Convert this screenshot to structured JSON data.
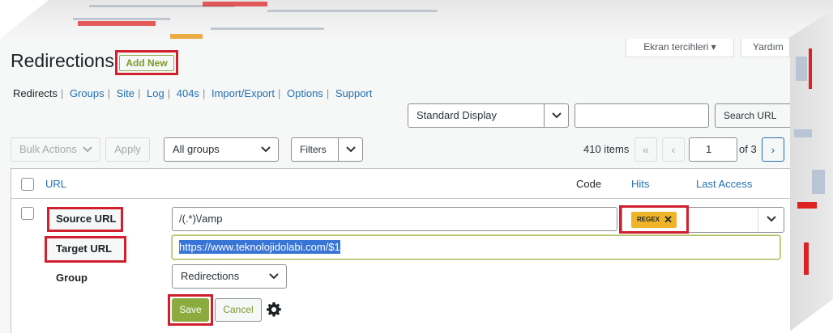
{
  "page": {
    "title": "Redirections",
    "add_new_label": "Add New",
    "screen_options_label": "Ekran tercihleri",
    "help_label": "Yardım"
  },
  "subnav": {
    "items": [
      "Redirects",
      "Groups",
      "Site",
      "Log",
      "404s",
      "Import/Export",
      "Options",
      "Support"
    ]
  },
  "toolbar": {
    "display_select_value": "Standard Display",
    "search_input_value": "",
    "search_button_label": "Search URL",
    "bulk_actions_value": "Bulk Actions",
    "apply_label": "Apply",
    "groups_select_value": "All groups",
    "filters_label": "Filters"
  },
  "pagination": {
    "item_count": "410 items",
    "first_label": "«",
    "prev_label": "‹",
    "current_page": "1",
    "of_label": "of 3",
    "next_label": "›"
  },
  "table": {
    "columns": {
      "url": "URL",
      "code": "Code",
      "hits": "Hits",
      "last_access": "Last Access"
    }
  },
  "edit_form": {
    "source_label": "Source URL",
    "source_value": "/(.*)\\/amp",
    "target_label": "Target URL",
    "target_value": "https://www.teknolojidolabi.com/$1",
    "group_label": "Group",
    "group_value": "Redirections",
    "regex_badge": "REGEX",
    "regex_remove_glyph": "✕",
    "save_label": "Save",
    "cancel_label": "Cancel"
  },
  "colors": {
    "highlight_box": "#d01f2e",
    "link": "#2271b1",
    "save_button": "#8bab3f",
    "regex_badge": "#f0b429",
    "text_selection": "#3875d7"
  },
  "icons": [
    "chevron-down-icon",
    "gear-icon",
    "close-icon"
  ]
}
